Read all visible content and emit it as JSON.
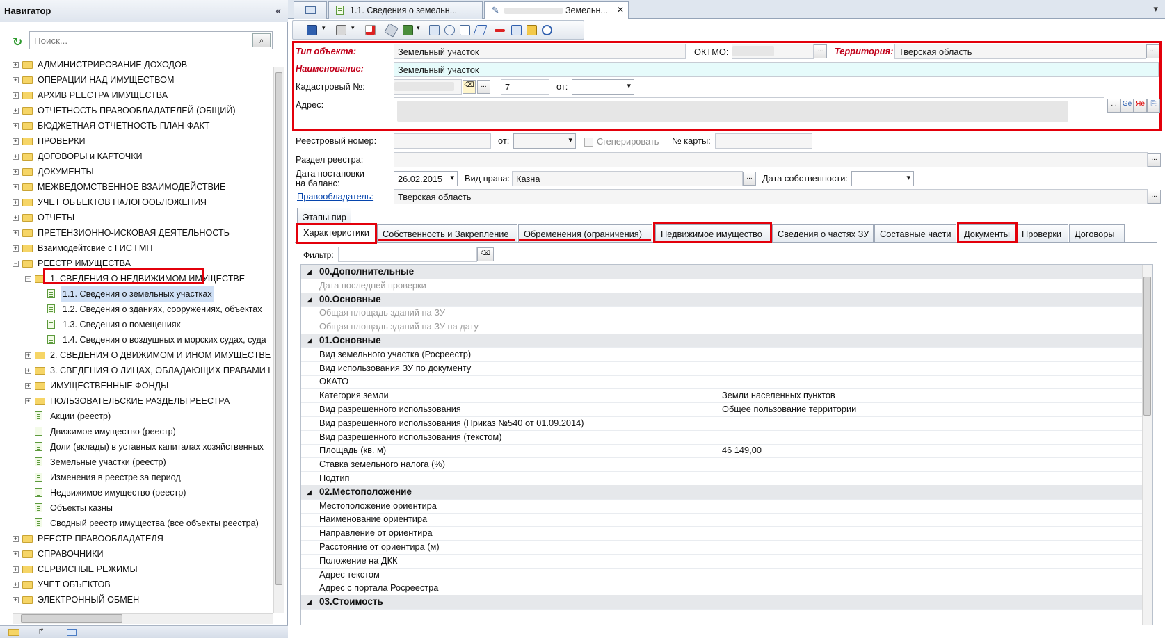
{
  "navigator": {
    "title": "Навигатор",
    "collapse_glyph": "«",
    "search_placeholder": "Поиск...",
    "refresh_icon": "↻",
    "search_icon": "⌕",
    "items": [
      {
        "label": "АДМИНИСТРИРОВАНИЕ ДОХОДОВ",
        "level": 0,
        "kind": "folder",
        "expander": "+"
      },
      {
        "label": "ОПЕРАЦИИ НАД ИМУЩЕСТВОМ",
        "level": 0,
        "kind": "folder",
        "expander": "+"
      },
      {
        "label": "АРХИВ РЕЕСТРА ИМУЩЕСТВА",
        "level": 0,
        "kind": "folder",
        "expander": "+"
      },
      {
        "label": "ОТЧЕТНОСТЬ ПРАВООБЛАДАТЕЛЕЙ (ОБЩИЙ)",
        "level": 0,
        "kind": "folder",
        "expander": "+"
      },
      {
        "label": "БЮДЖЕТНАЯ ОТЧЕТНОСТЬ ПЛАН-ФАКТ",
        "level": 0,
        "kind": "folder",
        "expander": "+"
      },
      {
        "label": "ПРОВЕРКИ",
        "level": 0,
        "kind": "folder",
        "expander": "+"
      },
      {
        "label": "ДОГОВОРЫ и КАРТОЧКИ",
        "level": 0,
        "kind": "folder",
        "expander": "+"
      },
      {
        "label": "ДОКУМЕНТЫ",
        "level": 0,
        "kind": "folder",
        "expander": "+"
      },
      {
        "label": "МЕЖВЕДОМСТВЕННОЕ ВЗАИМОДЕЙСТВИЕ",
        "level": 0,
        "kind": "folder",
        "expander": "+"
      },
      {
        "label": "УЧЕТ ОБЪЕКТОВ НАЛОГООБЛОЖЕНИЯ",
        "level": 0,
        "kind": "folder",
        "expander": "+"
      },
      {
        "label": "ОТЧЕТЫ",
        "level": 0,
        "kind": "folder",
        "expander": "+"
      },
      {
        "label": "ПРЕТЕНЗИОННО-ИСКОВАЯ ДЕЯТЕЛЬНОСТЬ",
        "level": 0,
        "kind": "folder",
        "expander": "+"
      },
      {
        "label": "Взаимодейтсвие с ГИС ГМП",
        "level": 0,
        "kind": "folder",
        "expander": "+"
      },
      {
        "label": "РЕЕСТР ИМУЩЕСТВА",
        "level": 0,
        "kind": "folder",
        "expander": "−"
      },
      {
        "label": "1. СВЕДЕНИЯ О НЕДВИЖИМОМ ИМУЩЕСТВЕ",
        "level": 1,
        "kind": "folder",
        "expander": "−"
      },
      {
        "label": "1.1. Сведения о земельных участках",
        "level": 2,
        "kind": "doc",
        "expander": "",
        "selected": true
      },
      {
        "label": "1.2. Сведения о зданиях, сооружениях, объектах",
        "level": 2,
        "kind": "doc",
        "expander": ""
      },
      {
        "label": "1.3. Сведения о помещениях",
        "level": 2,
        "kind": "doc",
        "expander": ""
      },
      {
        "label": "1.4. Сведения о воздушных и морских судах, суда",
        "level": 2,
        "kind": "doc",
        "expander": ""
      },
      {
        "label": "2. СВЕДЕНИЯ О ДВИЖИМОМ И ИНОМ ИМУЩЕСТВЕ",
        "level": 1,
        "kind": "folder",
        "expander": "+"
      },
      {
        "label": "3. СВЕДЕНИЯ О ЛИЦАХ, ОБЛАДАЮЩИХ ПРАВАМИ Н",
        "level": 1,
        "kind": "folder",
        "expander": "+"
      },
      {
        "label": "ИМУЩЕСТВЕННЫЕ ФОНДЫ",
        "level": 1,
        "kind": "folder",
        "expander": "+"
      },
      {
        "label": "ПОЛЬЗОВАТЕЛЬСКИЕ РАЗДЕЛЫ РЕЕСТРА",
        "level": 1,
        "kind": "folder",
        "expander": "+"
      },
      {
        "label": "Акции (реестр)",
        "level": 1,
        "kind": "doc",
        "expander": ""
      },
      {
        "label": "Движимое имущество (реестр)",
        "level": 1,
        "kind": "doc",
        "expander": ""
      },
      {
        "label": "Доли (вклады) в уставных капиталах хозяйственных",
        "level": 1,
        "kind": "doc",
        "expander": ""
      },
      {
        "label": "Земельные участки (реестр)",
        "level": 1,
        "kind": "doc",
        "expander": ""
      },
      {
        "label": "Изменения в реестре за период",
        "level": 1,
        "kind": "doc",
        "expander": ""
      },
      {
        "label": "Недвижимое имущество (реестр)",
        "level": 1,
        "kind": "doc",
        "expander": ""
      },
      {
        "label": "Объекты казны",
        "level": 1,
        "kind": "doc",
        "expander": ""
      },
      {
        "label": "Сводный реестр имущества (все объекты реестра)",
        "level": 1,
        "kind": "doc",
        "expander": ""
      },
      {
        "label": "РЕЕСТР ПРАВООБЛАДАТЕЛЯ",
        "level": 0,
        "kind": "folder",
        "expander": "+"
      },
      {
        "label": "СПРАВОЧНИКИ",
        "level": 0,
        "kind": "folder",
        "expander": "+"
      },
      {
        "label": "СЕРВИСНЫЕ РЕЖИМЫ",
        "level": 0,
        "kind": "folder",
        "expander": "+"
      },
      {
        "label": "УЧЕТ ОБЪЕКТОВ",
        "level": 0,
        "kind": "folder",
        "expander": "+"
      },
      {
        "label": "ЭЛЕКТРОННЫЙ ОБМЕН",
        "level": 0,
        "kind": "folder",
        "expander": "+"
      }
    ]
  },
  "doc_tabs": [
    {
      "label": "",
      "icon": "grid-icon"
    },
    {
      "label": "1.1. Сведения о земельн...",
      "icon": "doc-icon"
    },
    {
      "label": "Земельн...",
      "icon": "edit-icon",
      "close": "✕",
      "active": true
    }
  ],
  "window_menu_glyph": "▾",
  "form": {
    "object_type_label": "Тип объекта:",
    "object_type_value": "Земельный участок",
    "oktmo_label": "ОКТМО:",
    "territory_label": "Территория:",
    "territory_value": "Тверская область",
    "name_label": "Наименование:",
    "name_value": "Земельный участок",
    "cadastral_label": "Кадастровый №:",
    "cadastral_count": "7",
    "cadastral_from_label": "от:",
    "address_label": "Адрес:",
    "address_buttons": [
      "...",
      "Ge",
      "Яе",
      "⎘"
    ],
    "registry_number_label": "Реестровый номер:",
    "registry_from_label": "от:",
    "generate_label": "Сгенерировать",
    "map_number_label": "№ карты:",
    "registry_section_label": "Раздел реестра:",
    "balance_date_label_1": "Дата постановки",
    "balance_date_label_2": "на баланс:",
    "balance_date_value": "26.02.2015",
    "right_kind_label": "Вид права:",
    "right_kind_value": "Казна",
    "ownership_date_label": "Дата собственности:",
    "right_holder_link": "Правообладатель:",
    "right_holder_value": "Тверская область",
    "ellipsis": "..."
  },
  "stages_tab": "Этапы пир",
  "page_tabs": [
    {
      "label": "Характеристики",
      "active": true
    },
    {
      "label": "Собственность и Закрепление"
    },
    {
      "label": "Обременения (ограничения)"
    },
    {
      "label": "Недвижимое имущество"
    },
    {
      "label": "Сведения о частях ЗУ"
    },
    {
      "label": "Составные части"
    },
    {
      "label": "Документы"
    },
    {
      "label": "Проверки"
    },
    {
      "label": "Договоры"
    }
  ],
  "filter_label": "Фильтр:",
  "grid_rows": [
    {
      "name": "00.Дополнительные",
      "value": "",
      "group": true
    },
    {
      "name": "Дата последней проверки",
      "value": "",
      "dim": true
    },
    {
      "name": "00.Основные",
      "value": "",
      "group": true
    },
    {
      "name": "Общая площадь зданий на ЗУ",
      "value": "",
      "dim": true
    },
    {
      "name": "Общая площадь зданий на ЗУ на дату",
      "value": "",
      "dim": true
    },
    {
      "name": "01.Основные",
      "value": "",
      "group": true
    },
    {
      "name": "Вид земельного участка (Росреестр)",
      "value": ""
    },
    {
      "name": "Вид использования ЗУ по документу",
      "value": ""
    },
    {
      "name": "ОКАТО",
      "value": ""
    },
    {
      "name": "Категория земли",
      "value": "Земли населенных пунктов"
    },
    {
      "name": "Вид разрешенного использования",
      "value": "Общее пользование территории"
    },
    {
      "name": "Вид разрешенного использования (Приказ №540 от 01.09.2014)",
      "value": ""
    },
    {
      "name": "Вид разрешенного использования (текстом)",
      "value": ""
    },
    {
      "name": "Площадь (кв. м)",
      "value": "46 149,00"
    },
    {
      "name": "Ставка земельного налога (%)",
      "value": ""
    },
    {
      "name": " Подтип",
      "value": ""
    },
    {
      "name": "02.Местоположение",
      "value": "",
      "group": true
    },
    {
      "name": "Местоположение ориентира",
      "value": ""
    },
    {
      "name": "Наименование ориентира",
      "value": ""
    },
    {
      "name": "Направление от ориентира",
      "value": ""
    },
    {
      "name": "Расстояние от ориентира (м)",
      "value": ""
    },
    {
      "name": "Положение на ДКК",
      "value": ""
    },
    {
      "name": "Адрес текстом",
      "value": ""
    },
    {
      "name": "Адрес с портала Росреестра",
      "value": ""
    },
    {
      "name": "03.Стоимость",
      "value": "",
      "group": true
    }
  ],
  "colors": {
    "highlight_red": "#e3000b",
    "label_red": "#c0001a",
    "selection_blue": "#cfe0f6",
    "link_blue": "#0645ad"
  }
}
